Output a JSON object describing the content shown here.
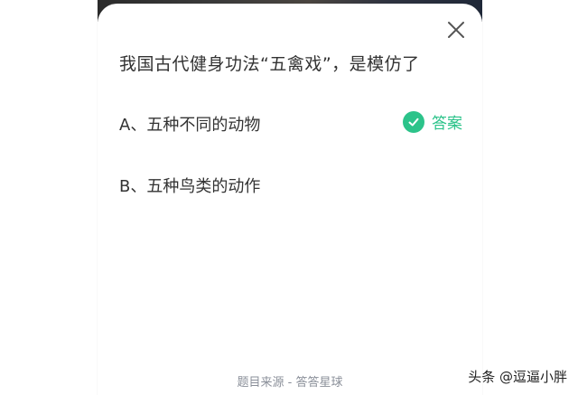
{
  "question": {
    "text": "我国古代健身功法“五禽戏”，是模仿了"
  },
  "options": [
    {
      "label": "A、五种不同的动物"
    },
    {
      "label": "B、五种鸟类的动作"
    }
  ],
  "answer_badge": {
    "label": "答案",
    "icon": "check-circle-icon",
    "color": "#2cc38a"
  },
  "close": {
    "icon": "close-icon"
  },
  "footer": {
    "text": "题目来源 - 答答星球"
  },
  "watermark": {
    "text": "头条 @逗逼小胖"
  }
}
